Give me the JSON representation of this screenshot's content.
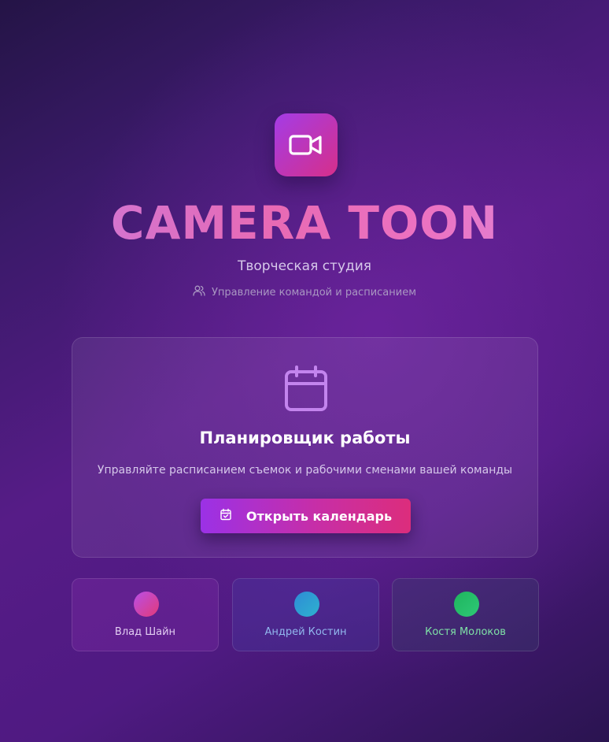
{
  "header": {
    "logo_icon": "video-camera-icon",
    "title": "CAMERA TOON",
    "subtitle": "Творческая студия",
    "tagline_icon": "users-icon",
    "tagline": "Управление командой и расписанием"
  },
  "planner": {
    "icon": "calendar-icon",
    "title": "Планировщик работы",
    "description": "Управляйте расписанием съемок и рабочими сменами вашей команды",
    "button_icon": "calendar-check-icon",
    "button_label": "Открыть календарь"
  },
  "team": [
    {
      "name": "Влад Шайн",
      "color": "#e2cdf2"
    },
    {
      "name": "Андрей Костин",
      "color": "#92b8ee"
    },
    {
      "name": "Костя Молоков",
      "color": "#7fe2a7"
    }
  ],
  "colors": {
    "accent_purple": "#9b31e6",
    "accent_pink": "#dc2d7c"
  }
}
